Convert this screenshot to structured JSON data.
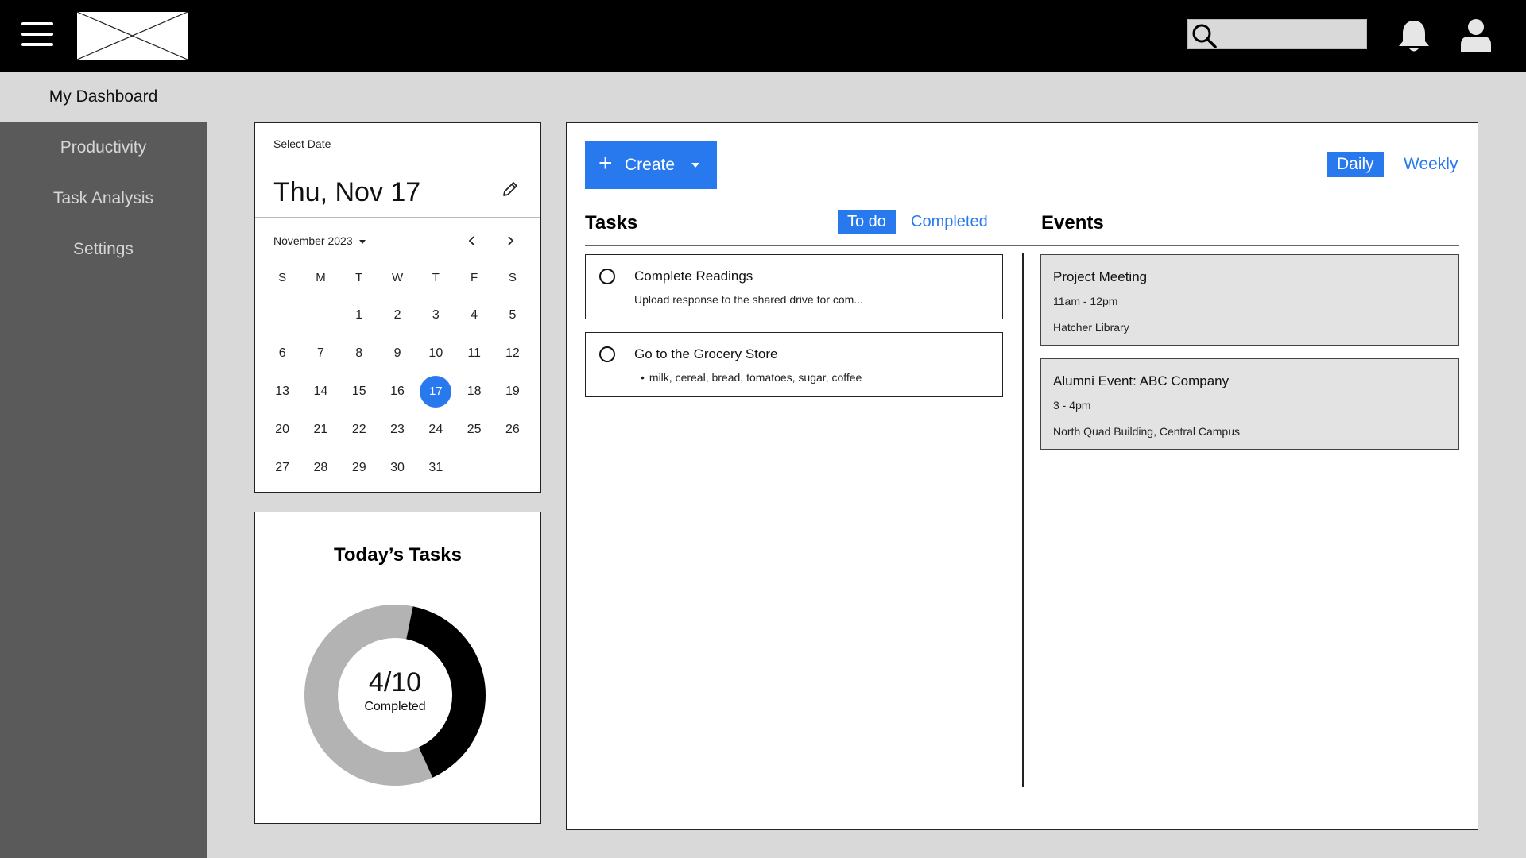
{
  "colors": {
    "accent": "#2979ee",
    "topbar": "#000000",
    "sidebar": "#5a5a5a",
    "background": "#d9d9d9",
    "donut_completed": "#000000",
    "donut_remaining": "#b3b3b3"
  },
  "header": {
    "menu_icon": "hamburger-icon",
    "search_icon": "search-icon",
    "notification_icon": "bell-icon",
    "profile_icon": "user-icon",
    "search_placeholder": ""
  },
  "sidebar": {
    "active": "My Dashboard",
    "items": [
      {
        "label": "Productivity"
      },
      {
        "label": "Task Analysis"
      },
      {
        "label": "Settings"
      }
    ]
  },
  "calendar": {
    "label": "Select Date",
    "selected_display": "Thu, Nov 17",
    "month": "November 2023",
    "weekdays": [
      "S",
      "M",
      "T",
      "W",
      "T",
      "F",
      "S"
    ],
    "weeks": [
      [
        "",
        "",
        "1",
        "2",
        "3",
        "4",
        "5"
      ],
      [
        "6",
        "7",
        "8",
        "9",
        "10",
        "11",
        "12"
      ],
      [
        "13",
        "14",
        "15",
        "16",
        "17",
        "18",
        "19"
      ],
      [
        "20",
        "21",
        "22",
        "23",
        "24",
        "25",
        "26"
      ],
      [
        "27",
        "28",
        "29",
        "30",
        "31",
        "",
        ""
      ]
    ],
    "selected_day": "17"
  },
  "today_tasks": {
    "title": "Today’s Tasks",
    "completed": 4,
    "total": 10,
    "display": "4/10",
    "sub": "Completed"
  },
  "main": {
    "create_label": "Create",
    "view_toggle": {
      "daily": "Daily",
      "weekly": "Weekly",
      "active": "Daily"
    },
    "tasks_title": "Tasks",
    "filter": {
      "todo": "To do",
      "completed": "Completed",
      "active": "To do"
    },
    "events_title": "Events",
    "tasks": [
      {
        "title": "Complete Readings",
        "desc": "Upload response to the shared drive for com..."
      },
      {
        "title": "Go to the Grocery Store",
        "desc": "milk, cereal, bread, tomatoes, sugar, coffee"
      }
    ],
    "events": [
      {
        "title": "Project Meeting",
        "time": "11am - 12pm",
        "location": "Hatcher Library"
      },
      {
        "title": "Alumni Event: ABC Company",
        "time": "3 - 4pm",
        "location": "North Quad Building, Central Campus"
      }
    ]
  }
}
